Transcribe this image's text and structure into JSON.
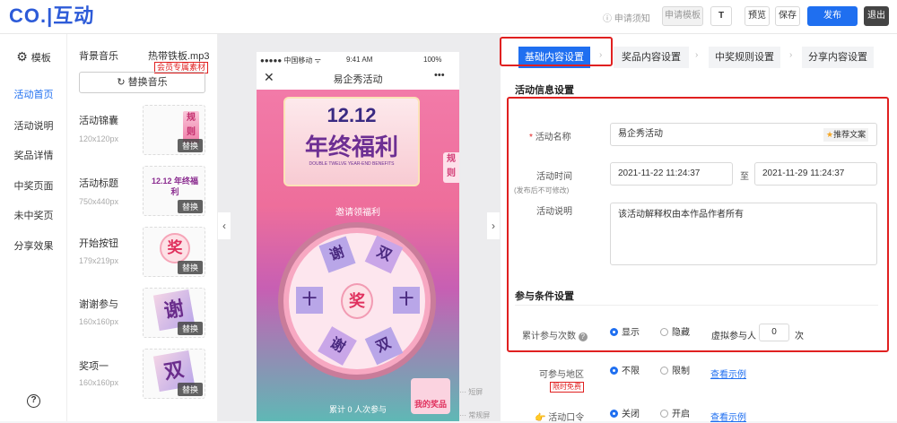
{
  "header": {
    "logo_text": "CO.|互动",
    "apply_note": "申请须知",
    "apply_template": "申请模板",
    "icon_t": "T",
    "preview": "预览",
    "save": "保存",
    "publish": "发布",
    "exit": "退出"
  },
  "nav": {
    "template": "模板",
    "items": [
      "活动首页",
      "活动说明",
      "奖品详情",
      "中奖页面",
      "未中奖页",
      "分享效果"
    ],
    "help": "?"
  },
  "assets": {
    "bgm_label": "背景音乐",
    "bgm_file": "热带铁板.mp3",
    "member_tag": "会员专属素材",
    "replace_music": "替换音乐",
    "items": [
      {
        "label": "活动锦囊",
        "size": "120x120px",
        "thumb": "规则"
      },
      {
        "label": "活动标题",
        "size": "750x440px",
        "thumb": "12.12 年终福利"
      },
      {
        "label": "开始按钮",
        "size": "179x219px",
        "thumb": "奖"
      },
      {
        "label": "谢谢参与",
        "size": "160x160px",
        "thumb": "谢"
      },
      {
        "label": "奖项一",
        "size": "160x160px",
        "thumb": "双"
      }
    ],
    "replace": "替换"
  },
  "phone": {
    "carrier": "●●●●● 中国移动 ᯤ",
    "time": "9:41 AM",
    "battery": "100%",
    "title": "易企秀活动",
    "close": "✕",
    "more": "•••",
    "banner_big": "12.12",
    "banner_title": "年终福利",
    "banner_sub": "DOUBLE TWELVE YEAR-END BENEFITS",
    "invite": "邀请领福利",
    "rule_tag": "规则",
    "center": "奖",
    "count": "累计 0 人次参与",
    "mine": "我的奖品",
    "short_screen": "短屏",
    "normal_screen": "常规屏",
    "wheel": [
      "谢",
      "双",
      "十",
      "十",
      "谢",
      "双"
    ]
  },
  "steps": [
    "基础内容设置",
    "奖品内容设置",
    "中奖规则设置",
    "分享内容设置"
  ],
  "form": {
    "section1": "活动信息设置",
    "name_label": "活动名称",
    "required": "*",
    "name_value": "易企秀活动",
    "recommend": "推荐文案",
    "time_label": "活动时间",
    "time_note": "(发布后不可修改)",
    "start": "2021-11-22 11:24:37",
    "to": "至",
    "end": "2021-11-29 11:24:37",
    "desc_label": "活动说明",
    "desc_value": "该活动解释权由本作品作者所有",
    "section2": "参与条件设置",
    "count_label": "累计参与次数",
    "show": "显示",
    "hide": "隐藏",
    "virtual_label": "虚拟参与人",
    "virtual_value": "0",
    "virtual_unit": "次",
    "region_label": "可参与地区",
    "free_tag": "限时免费",
    "unlimited": "不限",
    "limited": "限制",
    "example": "查看示例",
    "password_label": "活动口令",
    "off": "关闭",
    "on": "开启",
    "example2": "查看示例"
  },
  "colors": {
    "accent": "#1f6ff0",
    "red": "#e02020"
  }
}
